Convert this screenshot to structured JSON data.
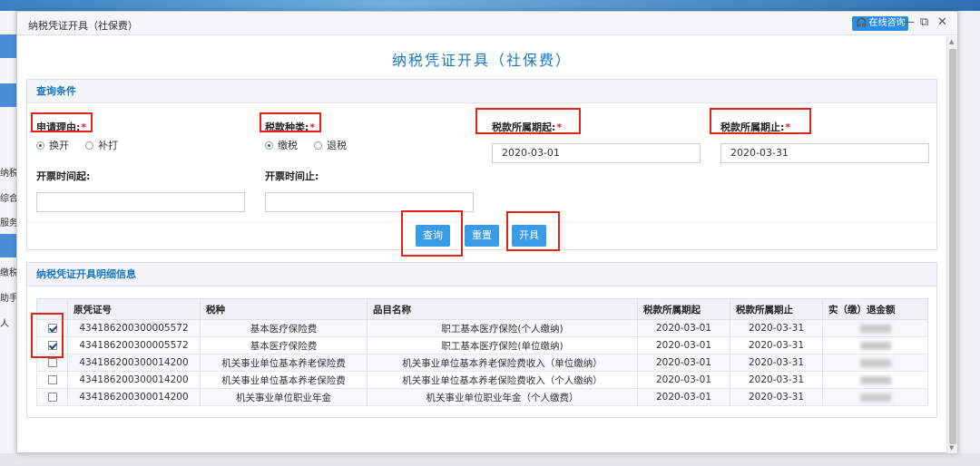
{
  "window": {
    "title": "纳税凭证开具（社保费）",
    "online_label": "在线咨询",
    "ctl_min": "—",
    "ctl_max": "⧉",
    "ctl_close": "✕"
  },
  "background": {
    "side_texts": [
      "纳税",
      "综合",
      "服务",
      "缴税",
      "助手",
      "人"
    ]
  },
  "page_title": "纳税凭证开具（社保费）",
  "query": {
    "header": "查询条件",
    "reason": {
      "label": "申请理由:",
      "options": [
        "换开",
        "补打"
      ],
      "selected": 0
    },
    "tax_type": {
      "label": "税款种类:",
      "options": [
        "缴税",
        "退税"
      ],
      "selected": 0
    },
    "period_start": {
      "label": "税款所属期起:",
      "value": "2020-03-01"
    },
    "period_end": {
      "label": "税款所属期止:",
      "value": "2020-03-31"
    },
    "ticket_start": {
      "label": "开票时间起:",
      "value": ""
    },
    "ticket_end": {
      "label": "开票时间止:",
      "value": ""
    },
    "required_mark": "*",
    "buttons": {
      "query": "查询",
      "reset": "重置",
      "issue": "开具"
    }
  },
  "detail": {
    "header": "纳税凭证开具明细信息",
    "columns": [
      "",
      "原凭证号",
      "税种",
      "品目名称",
      "税款所属期起",
      "税款所属期止",
      "实（缴）退金额"
    ],
    "rows": [
      {
        "checked": true,
        "voucher": "434186200300005572",
        "tax": "基本医疗保险费",
        "item": "职工基本医疗保险(个人缴纳)",
        "start": "2020-03-01",
        "end": "2020-03-31"
      },
      {
        "checked": true,
        "voucher": "434186200300005572",
        "tax": "基本医疗保险费",
        "item": "职工基本医疗保险(单位缴纳)",
        "start": "2020-03-01",
        "end": "2020-03-31"
      },
      {
        "checked": false,
        "voucher": "434186200300014200",
        "tax": "机关事业单位基本养老保险费",
        "item": "机关事业单位基本养老保险费收入（单位缴纳）",
        "start": "2020-03-01",
        "end": "2020-03-31"
      },
      {
        "checked": false,
        "voucher": "434186200300014200",
        "tax": "机关事业单位基本养老保险费",
        "item": "机关事业单位基本养老保险费收入（个人缴纳）",
        "start": "2020-03-01",
        "end": "2020-03-31"
      },
      {
        "checked": false,
        "voucher": "434186200300014200",
        "tax": "机关事业单位职业年金",
        "item": "机关事业单位职业年金（个人缴费）",
        "start": "2020-03-01",
        "end": "2020-03-31"
      }
    ]
  },
  "colors": {
    "accent": "#1a78c2",
    "button": "#3a9be6",
    "highlight": "#e2231a"
  }
}
